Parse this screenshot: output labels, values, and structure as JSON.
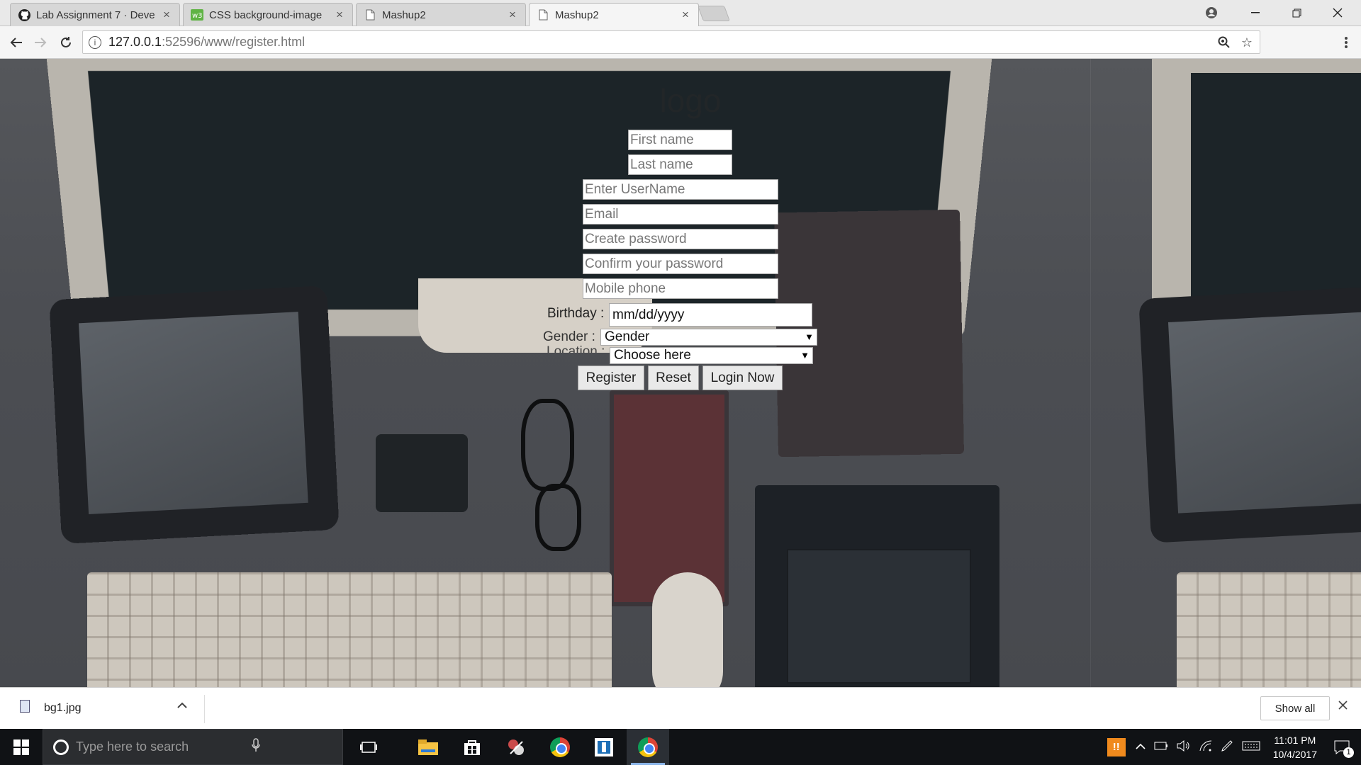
{
  "browser": {
    "tabs": [
      {
        "title": "Lab Assignment 7 · Deve",
        "icon": "github-icon"
      },
      {
        "title": "CSS background-image",
        "icon": "w3schools-icon"
      },
      {
        "title": "Mashup2",
        "icon": "page-icon"
      },
      {
        "title": "Mashup2",
        "icon": "page-icon",
        "active": true
      }
    ],
    "url_host": "127.0.0.1",
    "url_rest": ":52596/www/register.html"
  },
  "page": {
    "logo": "logo",
    "form": {
      "first_name_placeholder": "First name",
      "last_name_placeholder": "Last name",
      "username_placeholder": "Enter UserName",
      "email_placeholder": "Email",
      "password_placeholder": "Create password",
      "confirm_password_placeholder": "Confirm your password",
      "mobile_placeholder": "Mobile phone",
      "birthday_label": "Birthday :",
      "birthday_placeholder": "mm/dd/yyyy",
      "gender_label": "Gender :",
      "gender_selected": "Gender",
      "location_label": "Location :",
      "location_selected": "Choose here",
      "register_button": "Register",
      "reset_button": "Reset",
      "login_button": "Login Now"
    }
  },
  "downloads": {
    "file_name": "bg1.jpg",
    "show_all": "Show all"
  },
  "taskbar": {
    "search_placeholder": "Type here to search",
    "time": "11:01 PM",
    "date": "10/4/2017",
    "notification_count": "1"
  }
}
